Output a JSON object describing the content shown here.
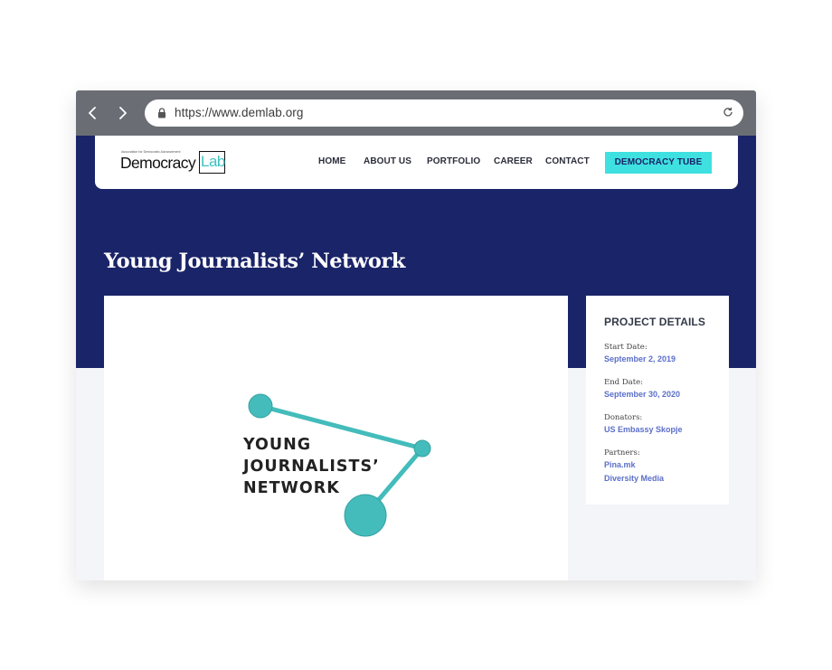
{
  "browser": {
    "url": "https://www.demlab.org"
  },
  "header": {
    "logo": {
      "tagline": "Association for Democratic Advancement",
      "name": "Democracy",
      "name_box": "Lab"
    },
    "nav": [
      {
        "label": "HOME"
      },
      {
        "label": "ABOUT US"
      },
      {
        "label": "PORTFOLIO"
      },
      {
        "label": "CAREER"
      },
      {
        "label": "CONTACT"
      }
    ],
    "cta_label": "DEMOCRACY TUBE"
  },
  "page": {
    "title": "Young Journalists’ Network"
  },
  "image": {
    "lines": [
      "YOUNG",
      "JOURNALISTS’",
      "NETWORK"
    ],
    "accent_color": "#43bcbb"
  },
  "details": {
    "heading": "PROJECT DETAILS",
    "start_label": "Start Date:",
    "start_value": "September 2, 2019",
    "end_label": "End Date:",
    "end_value": "September 30, 2020",
    "donators_label": "Donators:",
    "donators_value": "US Embassy Skopje",
    "partners_label": "Partners:",
    "partners": [
      "Pina.mk",
      "Diversity Media"
    ]
  },
  "colors": {
    "hero": "#1a2468",
    "cta": "#3ee0e0",
    "link": "#5b6fc9"
  }
}
